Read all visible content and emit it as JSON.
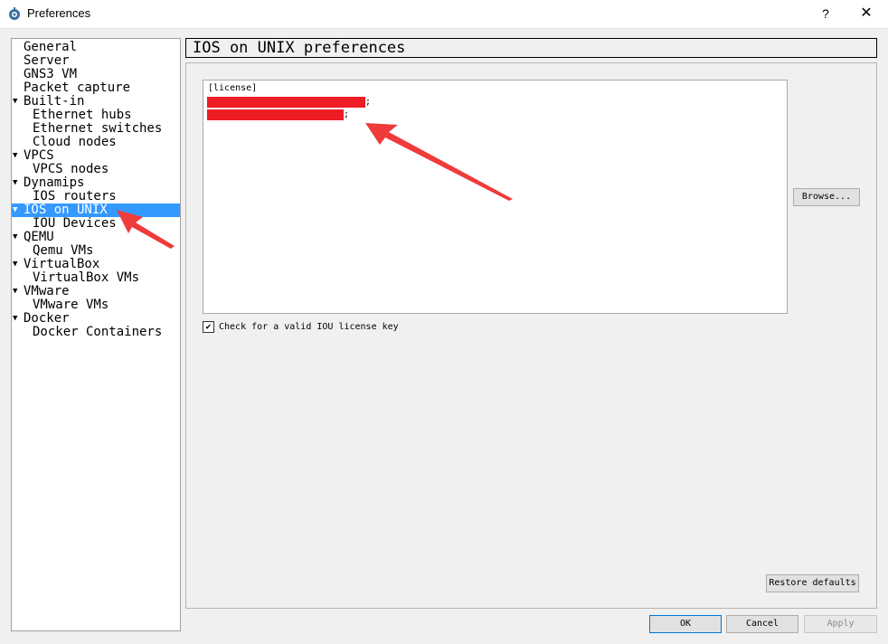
{
  "window": {
    "title": "Preferences",
    "help_label": "?",
    "close_label": "✕"
  },
  "sidebar": {
    "items": [
      {
        "label": "General",
        "indent": 0,
        "expander": ""
      },
      {
        "label": "Server",
        "indent": 0,
        "expander": ""
      },
      {
        "label": "GNS3 VM",
        "indent": 0,
        "expander": ""
      },
      {
        "label": "Packet capture",
        "indent": 0,
        "expander": ""
      },
      {
        "label": "Built-in",
        "indent": 0,
        "expander": "▼"
      },
      {
        "label": "Ethernet hubs",
        "indent": 1,
        "expander": ""
      },
      {
        "label": "Ethernet switches",
        "indent": 1,
        "expander": ""
      },
      {
        "label": "Cloud nodes",
        "indent": 1,
        "expander": ""
      },
      {
        "label": "VPCS",
        "indent": 0,
        "expander": "▼"
      },
      {
        "label": "VPCS nodes",
        "indent": 1,
        "expander": ""
      },
      {
        "label": "Dynamips",
        "indent": 0,
        "expander": "▼"
      },
      {
        "label": "IOS routers",
        "indent": 1,
        "expander": ""
      },
      {
        "label": "IOS on UNIX",
        "indent": 0,
        "expander": "▼",
        "selected": true
      },
      {
        "label": "IOU Devices",
        "indent": 1,
        "expander": ""
      },
      {
        "label": "QEMU",
        "indent": 0,
        "expander": "▼"
      },
      {
        "label": "Qemu VMs",
        "indent": 1,
        "expander": ""
      },
      {
        "label": "VirtualBox",
        "indent": 0,
        "expander": "▼"
      },
      {
        "label": "VirtualBox VMs",
        "indent": 1,
        "expander": ""
      },
      {
        "label": "VMware",
        "indent": 0,
        "expander": "▼"
      },
      {
        "label": "VMware VMs",
        "indent": 1,
        "expander": ""
      },
      {
        "label": "Docker",
        "indent": 0,
        "expander": "▼"
      },
      {
        "label": "Docker Containers",
        "indent": 1,
        "expander": ""
      }
    ]
  },
  "main": {
    "header": "IOS on UNIX preferences",
    "license": {
      "line1": "[license]",
      "semicolon": ";"
    },
    "browse_label": "Browse...",
    "check_label": "Check for a valid IOU license key",
    "check_mark": "✔",
    "restore_label": "Restore defaults"
  },
  "footer": {
    "ok": "OK",
    "cancel": "Cancel",
    "apply": "Apply"
  },
  "colors": {
    "selection": "#3399ff",
    "redaction": "#ee1c24",
    "annotation_arrow": "#ef3b3b"
  }
}
